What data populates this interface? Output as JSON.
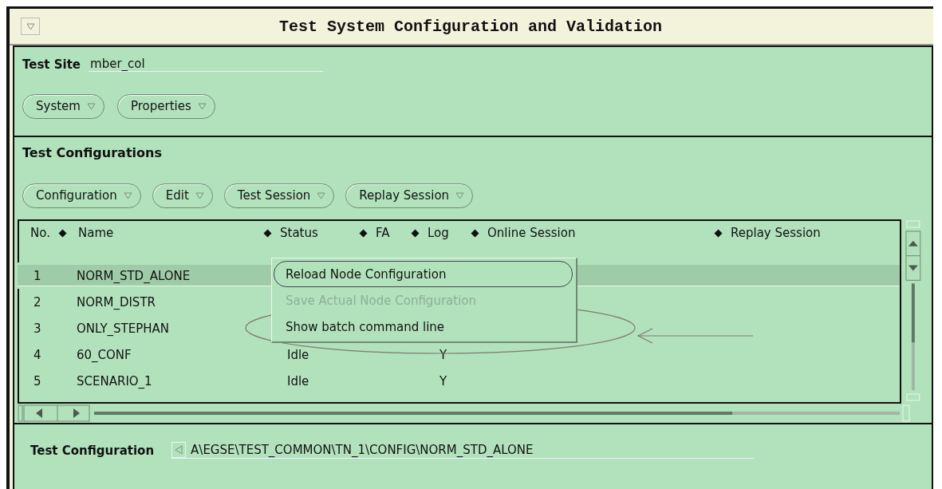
{
  "window": {
    "title": "Test System Configuration and Validation"
  },
  "test_site": {
    "label": "Test Site",
    "value": "mber_col"
  },
  "site_menus": [
    {
      "label": "System"
    },
    {
      "label": "Properties"
    }
  ],
  "configurations": {
    "heading": "Test Configurations",
    "menus": [
      {
        "label": "Configuration"
      },
      {
        "label": "Edit"
      },
      {
        "label": "Test Session"
      },
      {
        "label": "Replay Session"
      }
    ],
    "columns": [
      "No.",
      "Name",
      "Status",
      "FA",
      "Log",
      "Online Session",
      "Replay Session"
    ],
    "rows": [
      {
        "no": "1",
        "name": "NORM_STD_ALONE",
        "selected": true
      },
      {
        "no": "2",
        "name": "NORM_DISTR",
        "selected": false
      },
      {
        "no": "3",
        "name": "ONLY_STEPHAN",
        "selected": false
      },
      {
        "no": "4",
        "name": "60_CONF",
        "status": "Idle",
        "log": "Y",
        "selected": false
      },
      {
        "no": "5",
        "name": "SCENARIO_1",
        "status": "Idle",
        "log": "Y",
        "selected": false
      }
    ],
    "popup_menu": [
      {
        "label": "Reload Node Configuration",
        "selected": true,
        "disabled": false
      },
      {
        "label": "Save Actual Node Configuration",
        "selected": false,
        "disabled": true
      },
      {
        "label": "Show batch command line",
        "selected": false,
        "disabled": false
      }
    ]
  },
  "test_configuration": {
    "label": "Test Configuration",
    "value": "A\\EGSE\\TEST_COMMON\\TN_1\\CONFIG\\NORM_STD_ALONE"
  }
}
